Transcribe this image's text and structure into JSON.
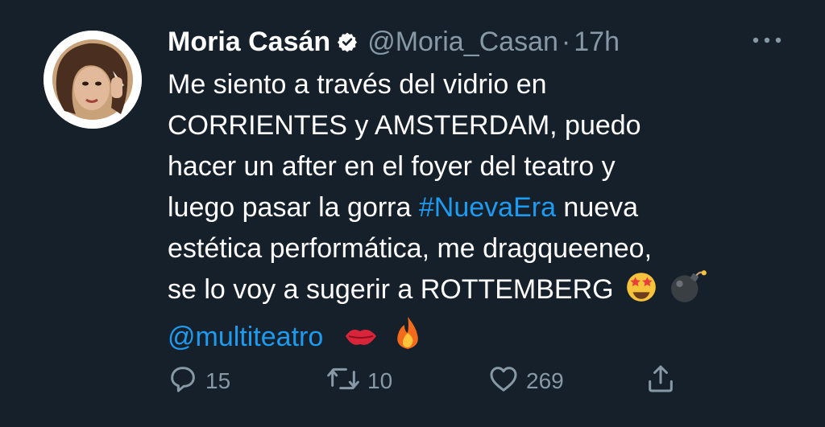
{
  "tweet": {
    "author": {
      "name": "Moria Casán",
      "handle": "@Moria_Casan",
      "separator": "·",
      "time": "17h",
      "verified": true
    },
    "text": {
      "line1": "Me siento a través del vidrio en",
      "line2": "CORRIENTES y AMSTERDAM, puedo",
      "line3": "hacer un after en el foyer del teatro y",
      "line4_before": "luego pasar la gorra ",
      "hashtag": "#NuevaEra",
      "line4_after": " nueva",
      "line5": "estética performática, me dragqueeneo,",
      "line6": "se lo voy a sugerir a  ROTTEMBERG",
      "mention": "@multiteatro"
    },
    "emojis": [
      "star-struck",
      "bomb",
      "kiss-mark",
      "fire"
    ],
    "stats": {
      "replies": "15",
      "retweets": "10",
      "likes": "269"
    },
    "icons": {
      "reply": "reply-icon",
      "retweet": "retweet-icon",
      "like": "heart-icon",
      "share": "share-icon",
      "more": "more-icon",
      "verified": "verified-badge-icon"
    },
    "colors": {
      "background": "#15202b",
      "text": "#ffffff",
      "secondary": "#8899a6",
      "link": "#1d9bf0"
    }
  }
}
